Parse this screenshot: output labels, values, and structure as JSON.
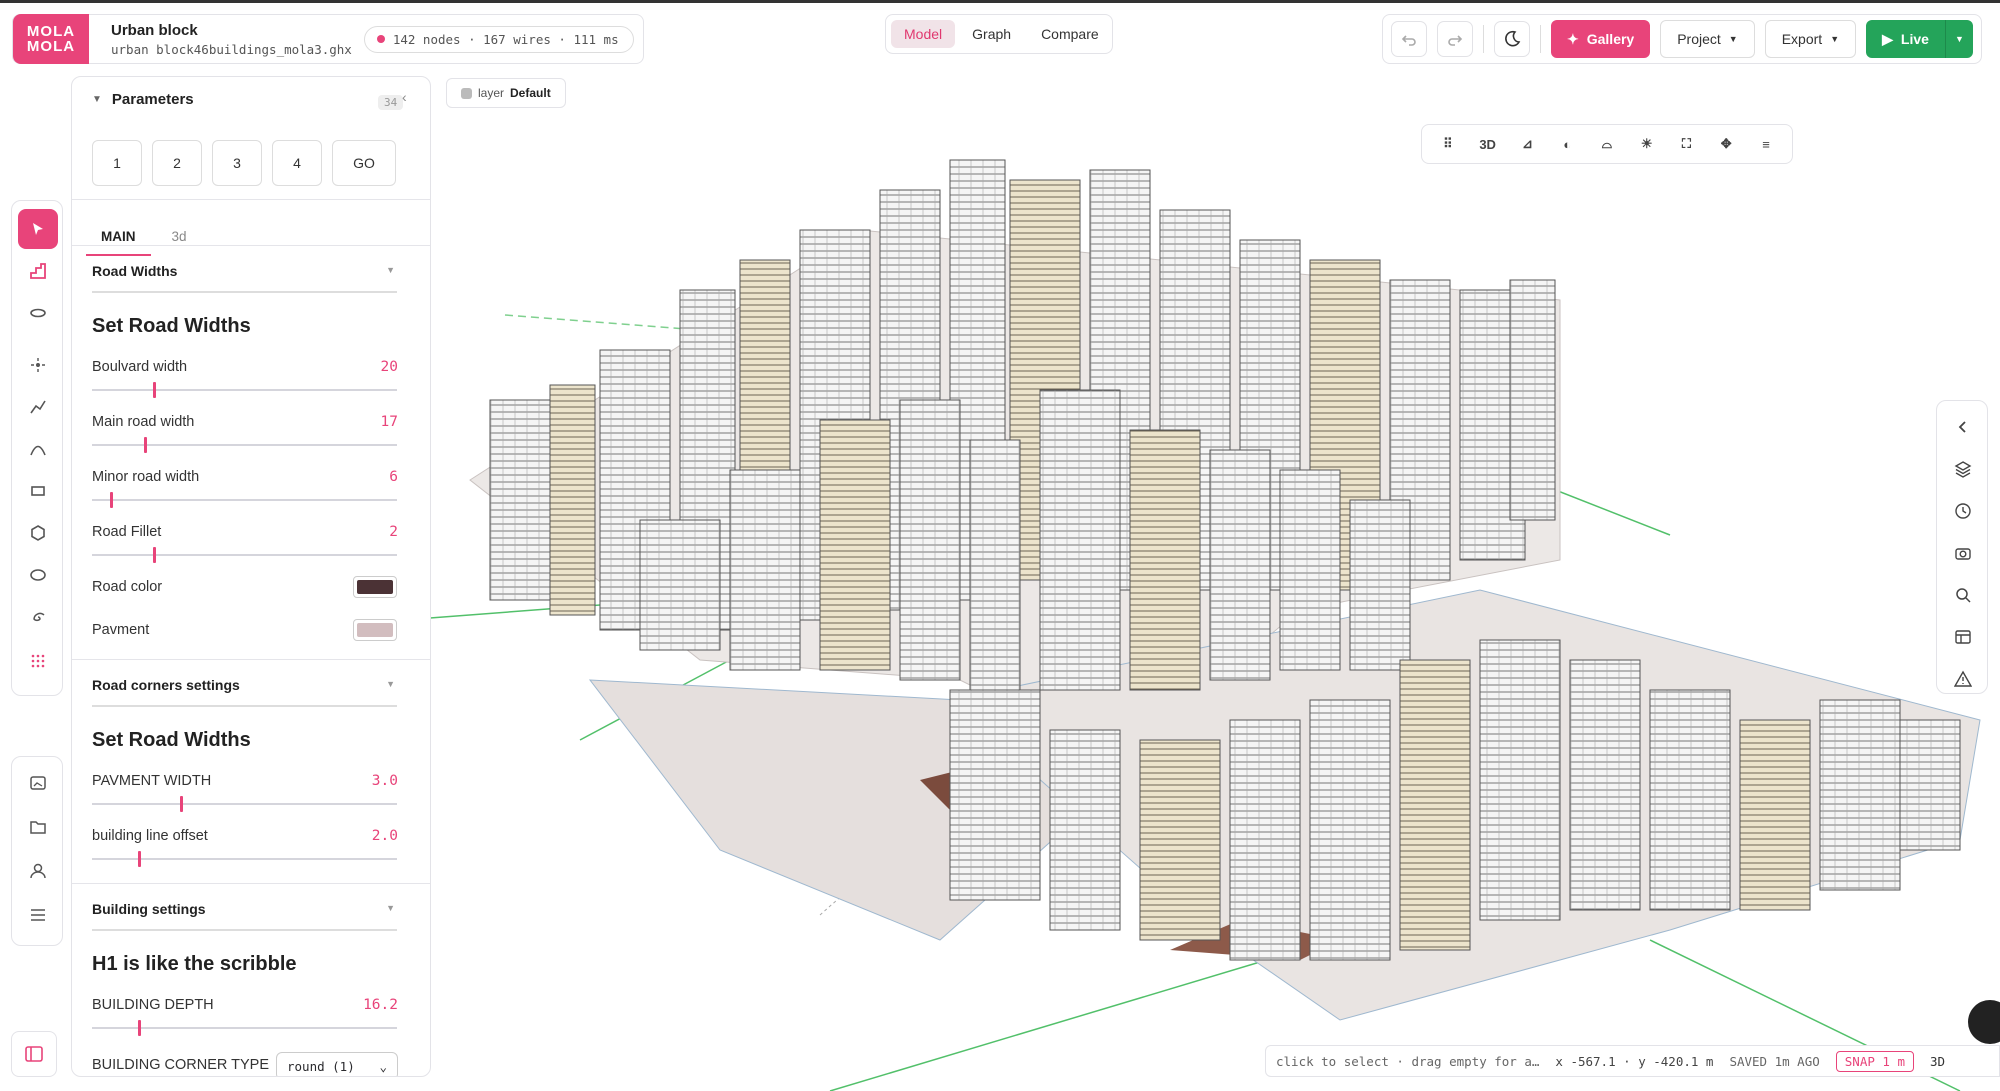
{
  "project": {
    "logo_line1": "MOLA",
    "logo_line2": "MOLA",
    "title": "Urban block",
    "filename": "urban block46buildings_mola3.ghx",
    "stats": "142 nodes · 167 wires · 111 ms"
  },
  "mode_tabs": [
    "Model",
    "Graph",
    "Compare"
  ],
  "toolbar": {
    "gallery": "Gallery",
    "project": "Project",
    "export": "Export",
    "live": "Live"
  },
  "layer": {
    "prefix": "layer",
    "name": "Default"
  },
  "view_toolbar": {
    "mode_3d": "3D"
  },
  "params": {
    "title": "Parameters",
    "count": "34",
    "presets": [
      "1",
      "2",
      "3",
      "4",
      "GO"
    ],
    "tabs": [
      "MAIN",
      "3d"
    ],
    "sections": [
      {
        "title": "Road Widths",
        "heading": "Set Road Widths",
        "sliders": [
          {
            "label": "Boulvard width",
            "value": "20",
            "fraction": 0.2
          },
          {
            "label": "Main road width",
            "value": "17",
            "fraction": 0.17
          },
          {
            "label": "Minor road width",
            "value": "6",
            "fraction": 0.06
          },
          {
            "label": "Road Fillet",
            "value": "2",
            "fraction": 0.2
          }
        ],
        "colors": [
          {
            "label": "Road color",
            "color": "#4b3235"
          },
          {
            "label": "Pavment",
            "color": "#d2bdbf"
          }
        ]
      },
      {
        "title": "Road corners settings",
        "heading": "Set Road Widths",
        "sliders": [
          {
            "label": "PAVMENT WIDTH",
            "value": "3.0",
            "fraction": 0.29
          },
          {
            "label": "building line offset",
            "value": "2.0",
            "fraction": 0.15
          }
        ]
      },
      {
        "title": "Building settings",
        "heading": "H1 is like the scribble",
        "sliders": [
          {
            "label": "BUILDING DEPTH",
            "value": "16.2",
            "fraction": 0.15
          }
        ],
        "select": {
          "label": "BUILDING CORNER TYPE",
          "value": "round (1)"
        }
      }
    ]
  },
  "status": {
    "hint": "click to select · drag empty for a…",
    "coords": "x -567.1 · y -420.1 m",
    "saved": "SAVED 1m AGO",
    "snap": "SNAP 1 m",
    "mode": "3D"
  },
  "colors": {
    "accent": "#e8447a",
    "live": "#24a45a"
  }
}
